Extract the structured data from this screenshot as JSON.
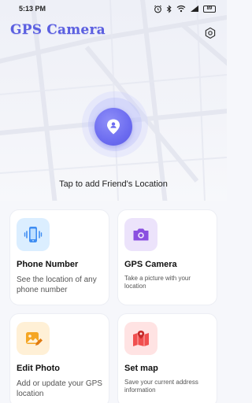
{
  "status_bar": {
    "time": "5:13 PM",
    "battery": "89"
  },
  "header": {
    "title": "GPS Camera"
  },
  "hero": {
    "hint": "Tap to add Friend's Location"
  },
  "cards": [
    {
      "title": "Phone Number",
      "desc": "See the location of any phone number",
      "icon": "phone-vibrate-icon",
      "color": "#dbeeff"
    },
    {
      "title": "GPS Camera",
      "desc": "Take a picture with your location",
      "icon": "camera-icon",
      "color": "#ece3fb"
    },
    {
      "title": "Edit Photo",
      "desc": "Add or update your GPS location",
      "icon": "edit-photo-icon",
      "color": "#fff0d6"
    },
    {
      "title": "Set map",
      "desc": "Save your current address information",
      "icon": "map-pin-icon",
      "color": "#ffe3e3"
    }
  ],
  "colors": {
    "accent": "#5b5fe0",
    "locate": "#6c6cf0"
  }
}
